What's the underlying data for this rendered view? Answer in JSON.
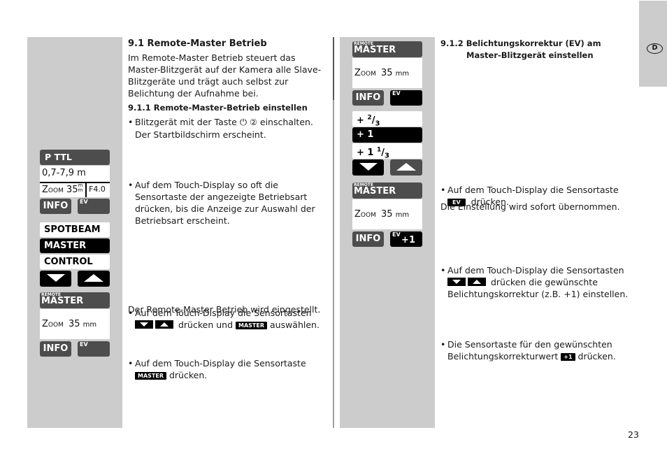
{
  "page": {
    "number": "23",
    "language_tab": "D"
  },
  "left_column": {
    "display1": {
      "mode": "P TTL",
      "range": "0,7-7,9 m",
      "zoom_label": "Zoom",
      "zoom_value": "35",
      "zoom_unit": "m/m",
      "aperture": "F4.0",
      "info_button": "INFO",
      "ev_button": "EV"
    },
    "selector": {
      "items": [
        "SPOTBEAM",
        "MASTER",
        "CONTROL"
      ],
      "selected": "MASTER"
    },
    "display2": {
      "remote_small": "REMOTE",
      "mode": "MASTER",
      "zoom_label": "Zoom",
      "zoom_value": "35",
      "zoom_unit": "mm",
      "info_button": "INFO",
      "ev_button": "EV"
    }
  },
  "section_91": {
    "title": "9.1 Remote-Master Betrieb",
    "intro": "Im Remote-Master Betrieb steuert das Master-Blitzgerät auf der Kamera alle Slave-Blitzgeräte und trägt auch selbst zur Belichtung der Aufnahme bei.",
    "sub_title": "9.1.1 Remote-Master-Betrieb einstellen",
    "step1_a": "Blitzgerät mit der Taste",
    "step1_icon": "power-icon",
    "step1_num": "②",
    "step1_b": "einschalten. Der Startbildschirm erscheint.",
    "step2": "Auf dem Touch-Display so oft die Sensortaste der angezeigte Betriebsart drücken, bis die Anzeige zur Auswahl der Betriebsart erscheint.",
    "step3_a": "Auf dem Touch-Display die Sensortasten",
    "step3_b": "drücken und",
    "step3_key": "MASTER",
    "step3_c": "auswählen.",
    "step4_a": "Auf dem Touch-Display die Sensortaste",
    "step4_key": "MASTER",
    "step4_b": "drücken.",
    "result": "Der Remote-Master Betrieb wird eingestellt."
  },
  "right_column": {
    "display1": {
      "remote_small": "REMOTE",
      "mode": "MASTER",
      "zoom_label": "Zoom",
      "zoom_value": "35",
      "zoom_unit": "mm",
      "info_button": "INFO",
      "ev_button": "EV"
    },
    "ev_selector": {
      "items": [
        "+ 2/3",
        "+ 1",
        "+ 1 1/3"
      ],
      "selected": "+ 1"
    },
    "display2": {
      "remote_small": "REMOTE",
      "mode": "MASTER",
      "zoom_label": "Zoom",
      "zoom_value": "35",
      "zoom_unit": "mm",
      "info_button": "INFO",
      "ev_button": "EV",
      "ev_value": "+1"
    }
  },
  "section_912": {
    "title_line1": "9.1.2 Belichtungskorrektur (EV) am",
    "title_line2": "Master-Blitzgerät einstellen",
    "step1_a": "Auf dem Touch-Display die Sensortaste",
    "step1_key": "EV",
    "step1_b": "drücken.",
    "step2_a": "Auf dem Touch-Display die Sensortasten",
    "step2_b": "drücken die gewünschte Belichtungskorrektur (z.B. +1) einstellen.",
    "step3_a": "Die Sensortaste für den gewünschten Belichtungskorrekturwert",
    "step3_key": "+1",
    "step3_b": "drücken.",
    "result": "Die Einstellung wird sofort übernommen."
  }
}
